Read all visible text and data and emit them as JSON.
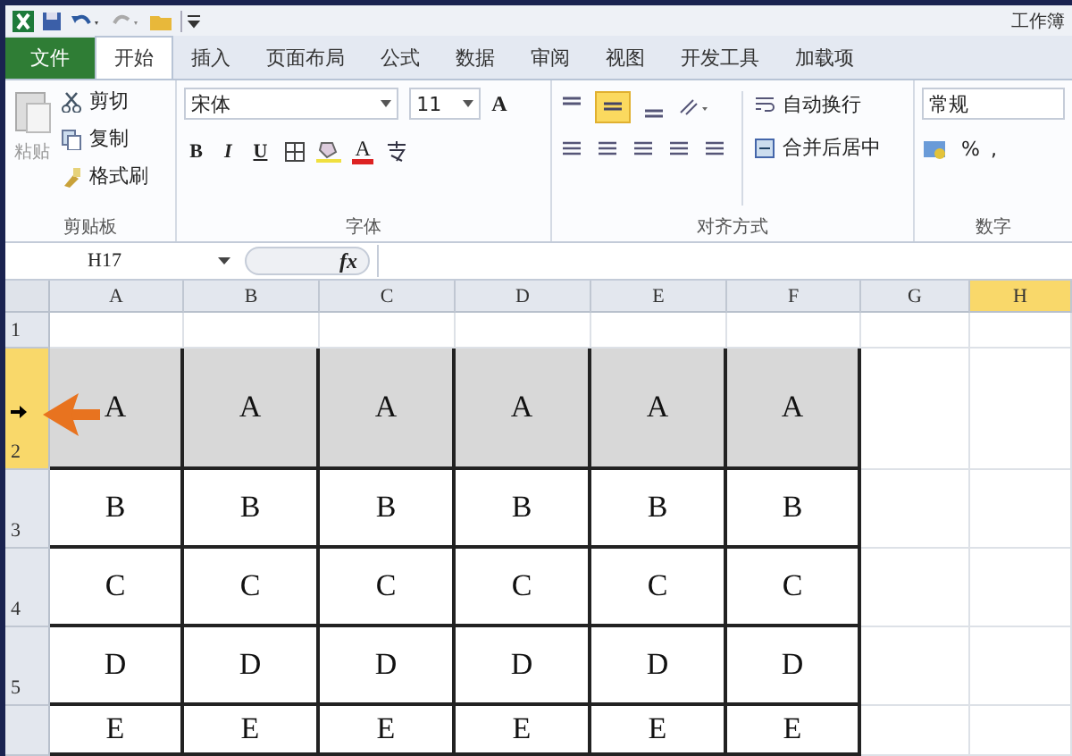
{
  "window": {
    "title": "工作簿"
  },
  "ribbon_tabs": [
    {
      "label": "文件",
      "kind": "file",
      "selected": false
    },
    {
      "label": "开始",
      "kind": "tab",
      "selected": true
    },
    {
      "label": "插入",
      "kind": "tab",
      "selected": false
    },
    {
      "label": "页面布局",
      "kind": "tab",
      "selected": false
    },
    {
      "label": "公式",
      "kind": "tab",
      "selected": false
    },
    {
      "label": "数据",
      "kind": "tab",
      "selected": false
    },
    {
      "label": "审阅",
      "kind": "tab",
      "selected": false
    },
    {
      "label": "视图",
      "kind": "tab",
      "selected": false
    },
    {
      "label": "开发工具",
      "kind": "tab",
      "selected": false
    },
    {
      "label": "加载项",
      "kind": "tab",
      "selected": false
    }
  ],
  "ribbon": {
    "clipboard": {
      "paste": "粘贴",
      "cut": "剪切",
      "copy": "复制",
      "format_painter": "格式刷",
      "label": "剪贴板"
    },
    "font": {
      "name": "宋体",
      "size": "11",
      "grow_font": "A",
      "font_color": "A",
      "bold": "B",
      "italic": "I",
      "underline": "U",
      "label": "字体"
    },
    "alignment": {
      "middle_align_selected": true,
      "wrap_text": "自动换行",
      "merge_center": "合并后居中",
      "label": "对齐方式"
    },
    "number": {
      "format": "常规",
      "percent": "%",
      "comma": ",",
      "label": "数字"
    }
  },
  "formula_bar": {
    "name_box": "H17",
    "function_label": "fx"
  },
  "sheet": {
    "columns": [
      {
        "label": "A",
        "selected": false
      },
      {
        "label": "B",
        "selected": false
      },
      {
        "label": "C",
        "selected": false
      },
      {
        "label": "D",
        "selected": false
      },
      {
        "label": "E",
        "selected": false
      },
      {
        "label": "F",
        "selected": false
      },
      {
        "label": "G",
        "selected": false
      },
      {
        "label": "H",
        "selected": true
      }
    ],
    "rows": [
      {
        "header": "1",
        "selected": false,
        "shaded": false
      },
      {
        "header": "2",
        "selected": true,
        "shaded": true,
        "cells": [
          "A",
          "A",
          "A",
          "A",
          "A",
          "A"
        ]
      },
      {
        "header": "3",
        "selected": false,
        "shaded": false,
        "cells": [
          "B",
          "B",
          "B",
          "B",
          "B",
          "B"
        ]
      },
      {
        "header": "4",
        "selected": false,
        "shaded": false,
        "cells": [
          "C",
          "C",
          "C",
          "C",
          "C",
          "C"
        ]
      },
      {
        "header": "5",
        "selected": false,
        "shaded": false,
        "cells": [
          "D",
          "D",
          "D",
          "D",
          "D",
          "D"
        ]
      },
      {
        "selected": false,
        "shaded": false,
        "cells": [
          "E",
          "E",
          "E",
          "E",
          "E",
          "E"
        ]
      }
    ]
  },
  "annotation": {
    "kind": "arrow-left"
  }
}
